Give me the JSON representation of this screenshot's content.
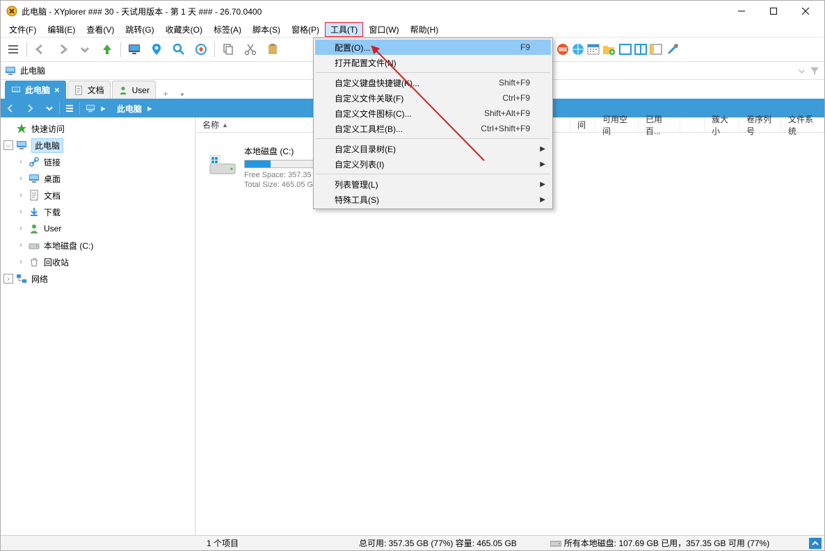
{
  "title": "此电脑 - XYplorer ### 30 - 天试用版本 - 第 1 天 ### - 26.70.0400",
  "menubar": [
    "文件(F)",
    "编辑(E)",
    "查看(V)",
    "跳转(G)",
    "收藏夹(O)",
    "标签(A)",
    "脚本(S)",
    "窗格(P)",
    "工具(T)",
    "窗口(W)",
    "帮助(H)"
  ],
  "menubar_highlight_index": 8,
  "address": "此电脑",
  "tabs": [
    {
      "label": "此电脑",
      "active": true
    },
    {
      "label": "文档",
      "active": false
    },
    {
      "label": "User",
      "active": false
    }
  ],
  "breadcrumb": {
    "root": "此电脑"
  },
  "tree": {
    "quick_access": {
      "label": "快速访问"
    },
    "this_pc": {
      "label": "此电脑"
    },
    "children": [
      {
        "label": "链接",
        "icon": "link"
      },
      {
        "label": "桌面",
        "icon": "desktop"
      },
      {
        "label": "文档",
        "icon": "doc"
      },
      {
        "label": "下载",
        "icon": "download"
      },
      {
        "label": "User",
        "icon": "user"
      },
      {
        "label": "本地磁盘 (C:)",
        "icon": "drive"
      },
      {
        "label": "回收站",
        "icon": "recycle"
      }
    ],
    "network": {
      "label": "网络"
    }
  },
  "columns": {
    "name": "名称",
    "c1": "间",
    "c2": "可用空间",
    "c3": "已用百...",
    "c4": "簇大小",
    "c5": "卷序列号",
    "c6": "文件系统"
  },
  "drive": {
    "name": "本地磁盘 (C:)",
    "free": "Free Space: 357.35",
    "total": "Total Size: 465.05 G",
    "fill_pct": 23
  },
  "dropdown": {
    "groups": [
      [
        {
          "label": "配置(O)...",
          "shortcut": "F9",
          "selected": true
        },
        {
          "label": "打开配置文件(N)",
          "shortcut": ""
        }
      ],
      [
        {
          "label": "自定义键盘快捷键(K)...",
          "shortcut": "Shift+F9"
        },
        {
          "label": "自定义文件关联(F)",
          "shortcut": "Ctrl+F9"
        },
        {
          "label": "自定义文件图标(C)...",
          "shortcut": "Shift+Alt+F9"
        },
        {
          "label": "自定义工具栏(B)...",
          "shortcut": "Ctrl+Shift+F9"
        }
      ],
      [
        {
          "label": "自定义目录树(E)",
          "sub": true
        },
        {
          "label": "自定义列表(I)",
          "sub": true
        }
      ],
      [
        {
          "label": "列表管理(L)",
          "sub": true
        },
        {
          "label": "特殊工具(S)",
          "sub": true
        }
      ]
    ]
  },
  "status": {
    "items": "1 个项目",
    "total": "总可用: 357.35 GB (77%)  容量: 465.05 GB",
    "drives": "所有本地磁盘: 107.69 GB 已用，357.35 GB 可用 (77%)"
  }
}
